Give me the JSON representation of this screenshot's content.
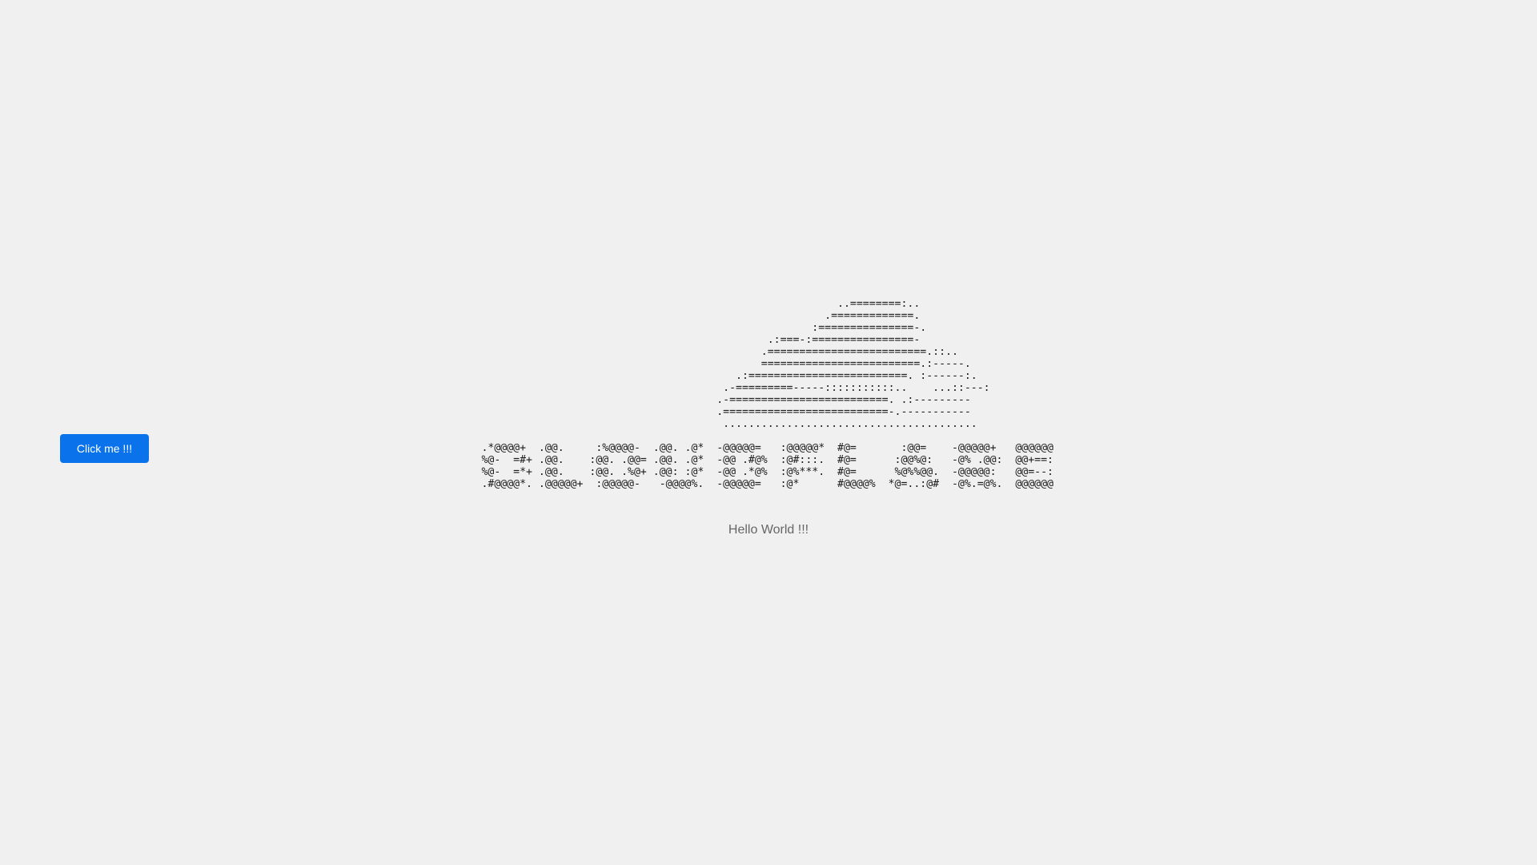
{
  "button": {
    "label": "Click me !!!"
  },
  "ascii_art": {
    "text": "                                                        ..========:..\n                                                      .=============.\n                                                    :===============-.\n                                             .:===-:================-\n                                            .=========================.::..\n                                            =========================.:-----.\n                                        .:=========================. :------:.\n                                      .-=========-----:::::::::::..    ...::---:\n                                     .-=========================. .:---------\n                                     .==========================-.-----------\n                                      ........................................\n\n.*@@@@+  .@@.     :%@@@@-  .@@. .@*  -@@@@@=   :@@@@@*  #@=       :@@=    -@@@@@+   @@@@@@\n%@-  =#+ .@@.    :@@. .@@= .@@. .@*  -@@ .#@%  :@#:::.  #@=      :@@%@:   -@% .@@:  @@+==:\n%@-  =*+ .@@.    :@@. .%@+ .@@: :@*  -@@ .*@%  :@%***.  #@=      %@%%@@.  -@@@@@:   @@=--:\n.#@@@@*. .@@@@@+  :@@@@@-   -@@@@%.  -@@@@@=   :@*      #@@@@%  *@=..:@#  -@%.=@%.  @@@@@@"
  },
  "greeting": {
    "text": "Hello World !!!"
  },
  "colors": {
    "accent": "#0a73ec",
    "background": "#f0f0f0",
    "muted_text": "#666666"
  }
}
